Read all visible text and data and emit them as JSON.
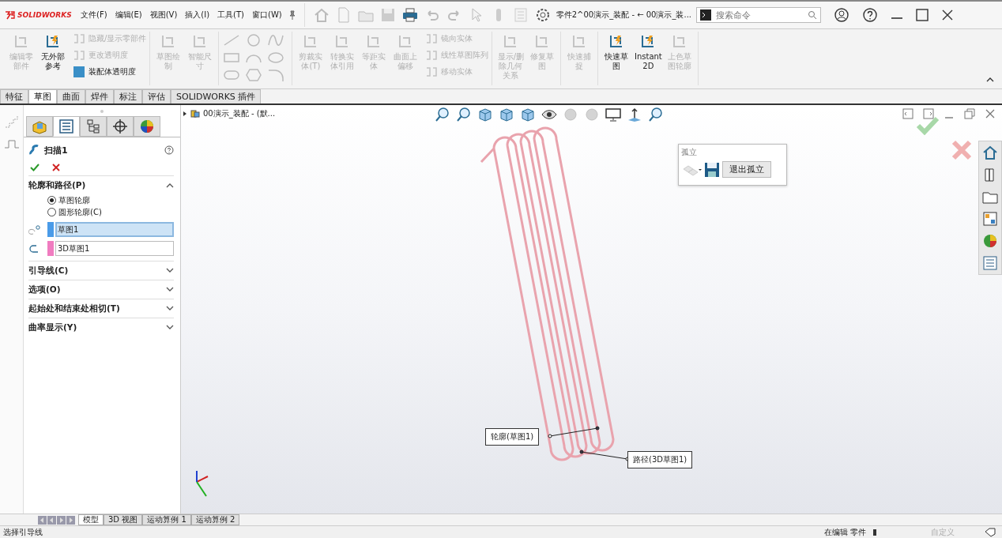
{
  "title_bar": {
    "logo": "SOLIDWORKS",
    "menus": [
      "文件(F)",
      "编辑(E)",
      "视图(V)",
      "插入(I)",
      "工具(T)",
      "窗口(W)"
    ],
    "document_title": "零件2^00演示_装配 - ← 00演示_装...",
    "search": {
      "placeholder": "搜索命令"
    }
  },
  "ribbon": {
    "groups": [
      {
        "items": [
          {
            "kind": "large",
            "label": "编辑零部件",
            "disabled": true
          },
          {
            "kind": "large",
            "label": "无外部参考",
            "disabled": false
          },
          {
            "kind": "stack",
            "entries": [
              {
                "label": "隐藏/显示零部件",
                "disabled": true
              },
              {
                "label": "更改透明度",
                "disabled": true
              },
              {
                "label": "装配体透明度",
                "disabled": false
              }
            ]
          }
        ]
      },
      {
        "items": [
          {
            "kind": "large",
            "label": "草图绘制",
            "disabled": true
          },
          {
            "kind": "large",
            "label": "智能尺寸",
            "disabled": true
          }
        ]
      },
      {
        "items": [
          {
            "kind": "tools"
          }
        ]
      },
      {
        "items": [
          {
            "kind": "large",
            "label": "剪裁实体(T)",
            "disabled": true
          },
          {
            "kind": "large",
            "label": "转换实体引用",
            "disabled": true
          },
          {
            "kind": "large",
            "label": "等距实体",
            "disabled": true
          },
          {
            "kind": "large",
            "label": "曲面上偏移",
            "disabled": true
          },
          {
            "kind": "stack",
            "entries": [
              {
                "label": "镜向实体",
                "disabled": true
              },
              {
                "label": "线性草图阵列",
                "disabled": true
              },
              {
                "label": "移动实体",
                "disabled": true
              }
            ]
          }
        ]
      },
      {
        "items": [
          {
            "kind": "large",
            "label": "显示/删除几何关系",
            "disabled": true
          },
          {
            "kind": "large",
            "label": "修复草图",
            "disabled": true
          }
        ]
      },
      {
        "items": [
          {
            "kind": "large",
            "label": "快速捕捉",
            "disabled": true
          }
        ]
      },
      {
        "items": [
          {
            "kind": "large",
            "label": "快速草图",
            "disabled": false
          },
          {
            "kind": "large",
            "label": "Instant2D",
            "disabled": false
          },
          {
            "kind": "large",
            "label": "上色草图轮廓",
            "disabled": true
          }
        ]
      }
    ]
  },
  "command_tabs": [
    {
      "label": "特征",
      "selected": false
    },
    {
      "label": "草图",
      "selected": true
    },
    {
      "label": "曲面",
      "selected": false
    },
    {
      "label": "焊件",
      "selected": false
    },
    {
      "label": "标注",
      "selected": false
    },
    {
      "label": "评估",
      "selected": false
    },
    {
      "label": "SOLIDWORKS 插件",
      "selected": false
    }
  ],
  "property_manager": {
    "tabs": [
      {
        "kind": "feature",
        "selected": false
      },
      {
        "kind": "property",
        "selected": true
      },
      {
        "kind": "config",
        "selected": false
      },
      {
        "kind": "target",
        "selected": false
      },
      {
        "kind": "display",
        "selected": false
      }
    ],
    "title": "扫描1",
    "sections": [
      {
        "label": "轮廓和路径(P)",
        "expanded": true,
        "options": [
          {
            "label": "草图轮廓",
            "selected": true
          },
          {
            "label": "圆形轮廓(C)",
            "selected": false
          }
        ],
        "selections": [
          {
            "value": "草图1",
            "color": "#4a9be8",
            "selected": true
          },
          {
            "value": "3D草图1",
            "color": "#f07cc0",
            "selected": false
          }
        ]
      },
      {
        "label": "引导线(C)",
        "expanded": false
      },
      {
        "label": "选项(O)",
        "expanded": false
      },
      {
        "label": "起始处和结束处相切(T)",
        "expanded": false
      },
      {
        "label": "曲率显示(Y)",
        "expanded": false
      }
    ]
  },
  "graphics": {
    "tree_item": "00演示_装配 - (默...",
    "isolate": {
      "title": "孤立",
      "button": "退出孤立"
    },
    "callouts": [
      {
        "label": "轮廓(草图1)"
      },
      {
        "label": "路径(3D草图1)"
      }
    ]
  },
  "bottom_tabs": [
    {
      "label": "模型",
      "selected": true
    },
    {
      "label": "3D 视图",
      "selected": false
    },
    {
      "label": "运动算例 1",
      "selected": false
    },
    {
      "label": "运动算例 2",
      "selected": false
    }
  ],
  "status_bar": {
    "message": "选择引导线",
    "mode": "在编辑 零件",
    "units": "自定义"
  }
}
